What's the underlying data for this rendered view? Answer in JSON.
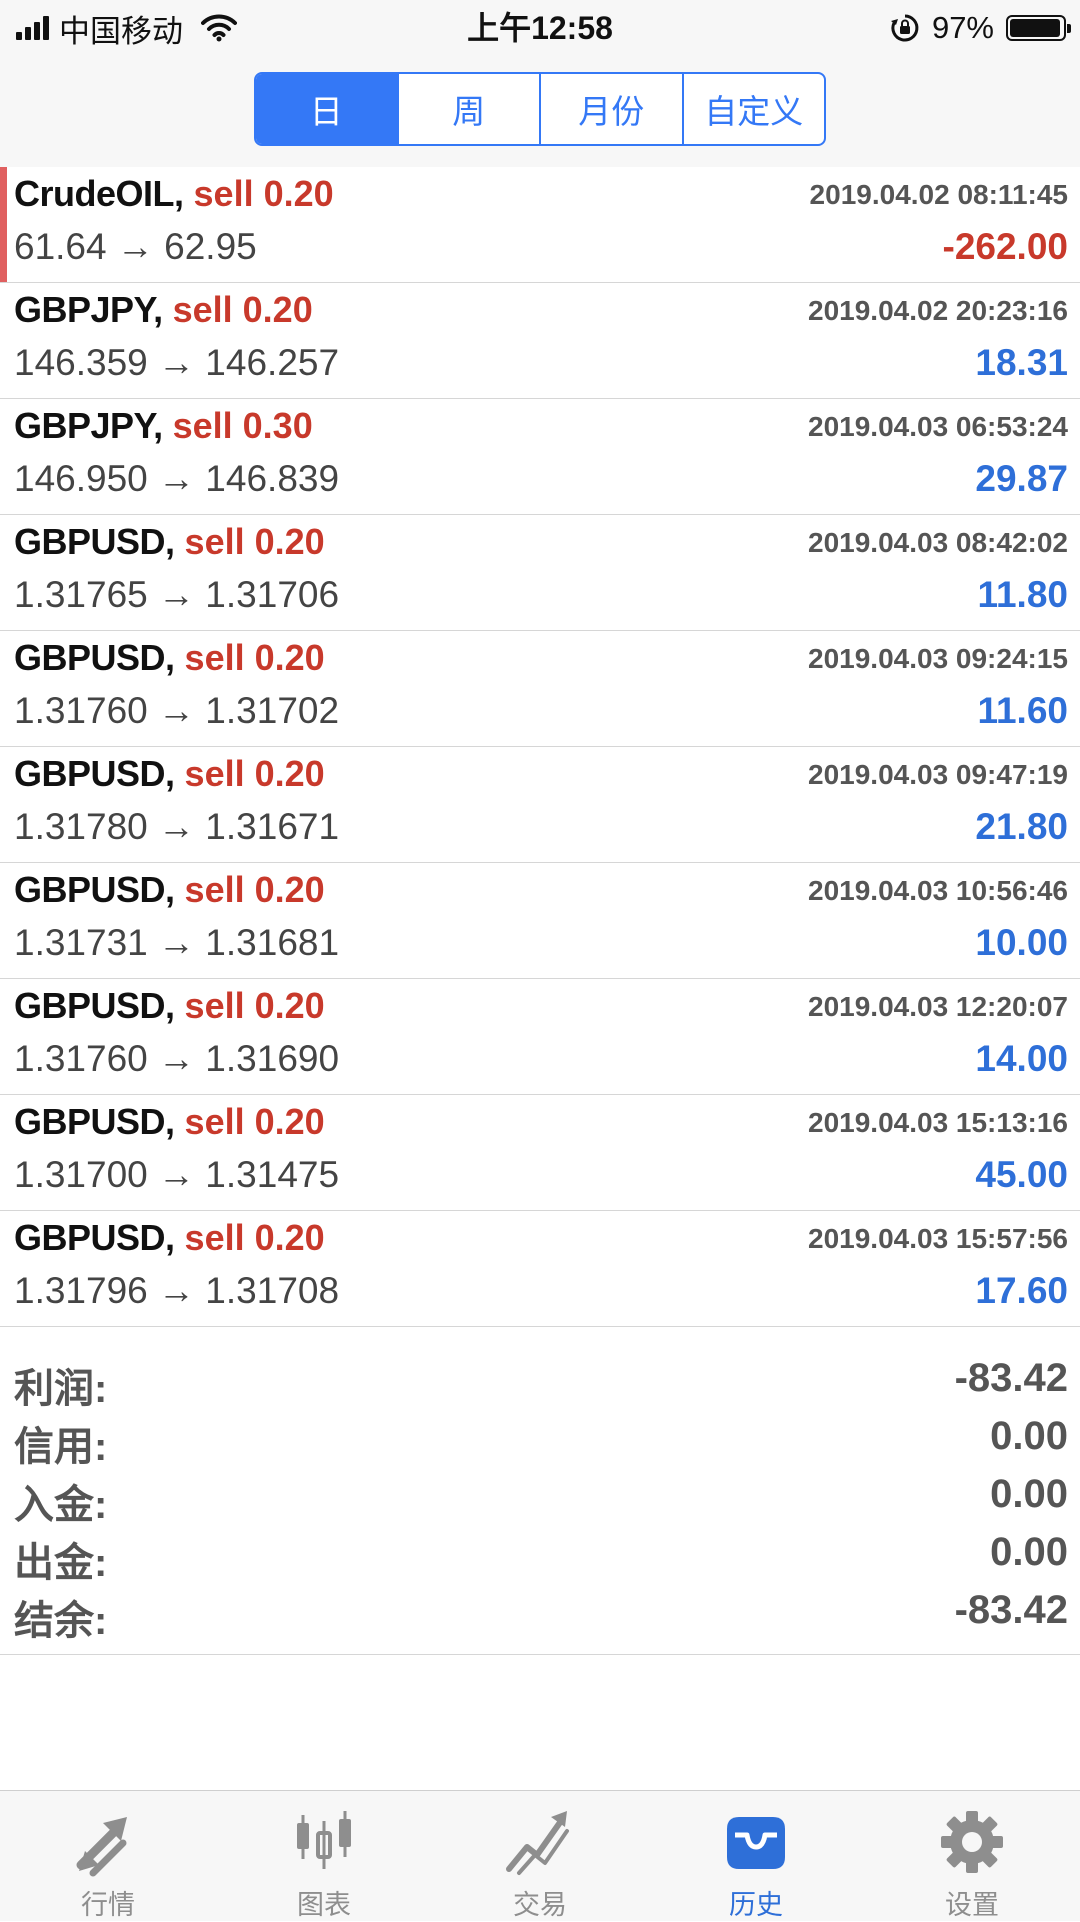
{
  "status_bar": {
    "carrier": "中国移动",
    "time": "上午12:58",
    "battery": "97%",
    "battery_level": 0.97
  },
  "header": {
    "segments": [
      {
        "label": "日",
        "active": true
      },
      {
        "label": "周",
        "active": false
      },
      {
        "label": "月份",
        "active": false
      },
      {
        "label": "自定义",
        "active": false
      }
    ]
  },
  "trades": [
    {
      "symbol": "CrudeOIL,",
      "side": "sell 0.20",
      "prices": "61.64 → 62.95",
      "time": "2019.04.02 08:11:45",
      "profit": "-262.00"
    },
    {
      "symbol": "GBPJPY,",
      "side": "sell 0.20",
      "prices": "146.359 → 146.257",
      "time": "2019.04.02 20:23:16",
      "profit": "18.31"
    },
    {
      "symbol": "GBPJPY,",
      "side": "sell 0.30",
      "prices": "146.950 → 146.839",
      "time": "2019.04.03 06:53:24",
      "profit": "29.87"
    },
    {
      "symbol": "GBPUSD,",
      "side": "sell 0.20",
      "prices": "1.31765 → 1.31706",
      "time": "2019.04.03 08:42:02",
      "profit": "11.80"
    },
    {
      "symbol": "GBPUSD,",
      "side": "sell 0.20",
      "prices": "1.31760 → 1.31702",
      "time": "2019.04.03 09:24:15",
      "profit": "11.60"
    },
    {
      "symbol": "GBPUSD,",
      "side": "sell 0.20",
      "prices": "1.31780 → 1.31671",
      "time": "2019.04.03 09:47:19",
      "profit": "21.80"
    },
    {
      "symbol": "GBPUSD,",
      "side": "sell 0.20",
      "prices": "1.31731 → 1.31681",
      "time": "2019.04.03 10:56:46",
      "profit": "10.00"
    },
    {
      "symbol": "GBPUSD,",
      "side": "sell 0.20",
      "prices": "1.31760 → 1.31690",
      "time": "2019.04.03 12:20:07",
      "profit": "14.00"
    },
    {
      "symbol": "GBPUSD,",
      "side": "sell 0.20",
      "prices": "1.31700 → 1.31475",
      "time": "2019.04.03 15:13:16",
      "profit": "45.00"
    },
    {
      "symbol": "GBPUSD,",
      "side": "sell 0.20",
      "prices": "1.31796 → 1.31708",
      "time": "2019.04.03 15:57:56",
      "profit": "17.60"
    }
  ],
  "summary": [
    {
      "label": "利润:",
      "value": "-83.42"
    },
    {
      "label": "信用:",
      "value": "0.00"
    },
    {
      "label": "入金:",
      "value": "0.00"
    },
    {
      "label": "出金:",
      "value": "0.00"
    },
    {
      "label": "结余:",
      "value": "-83.42"
    }
  ],
  "tabbar": [
    {
      "label": "行情",
      "icon": "quotes-arrows-icon",
      "active": false
    },
    {
      "label": "图表",
      "icon": "candlestick-chart-icon",
      "active": false
    },
    {
      "label": "交易",
      "icon": "trade-trend-icon",
      "active": false
    },
    {
      "label": "历史",
      "icon": "history-inbox-icon",
      "active": true
    },
    {
      "label": "设置",
      "icon": "gear-icon",
      "active": false
    }
  ],
  "colors": {
    "accent": "#3478f6",
    "profit_positive": "#2e6fd8",
    "profit_negative": "#c8392b",
    "sell": "#c8392b",
    "tab_inactive": "#8e8e8e"
  }
}
